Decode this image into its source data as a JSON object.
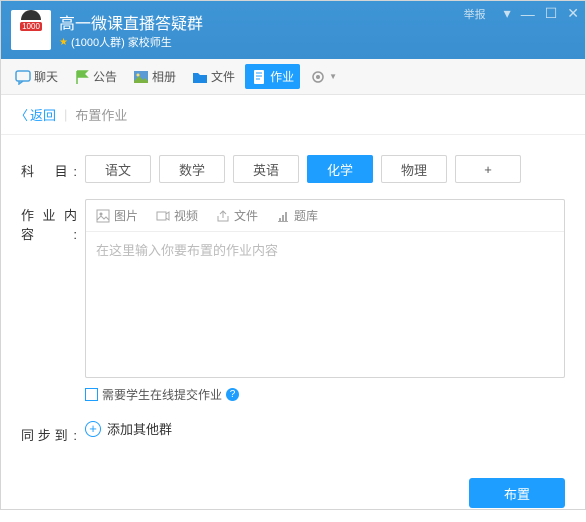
{
  "header": {
    "title": "高一微课直播答疑群",
    "badge": "1000",
    "member_label": "(1000人群)",
    "type_label": "家校师生",
    "report": "举报"
  },
  "toolbar": {
    "chat": "聊天",
    "notice": "公告",
    "album": "相册",
    "file": "文件",
    "homework": "作业"
  },
  "crumb": {
    "back": "返回",
    "current": "布置作业"
  },
  "form": {
    "subject_label": "科　目",
    "subjects": [
      "语文",
      "数学",
      "英语",
      "化学",
      "物理",
      "+"
    ],
    "subject_selected": 3,
    "content_label": "作业内容",
    "editor_tools": {
      "image": "图片",
      "video": "视频",
      "file": "文件",
      "bank": "题库"
    },
    "placeholder": "在这里输入你要布置的作业内容",
    "checkbox_label": "需要学生在线提交作业",
    "sync_label": "同步到",
    "add_group": "添加其他群",
    "submit": "布置"
  }
}
